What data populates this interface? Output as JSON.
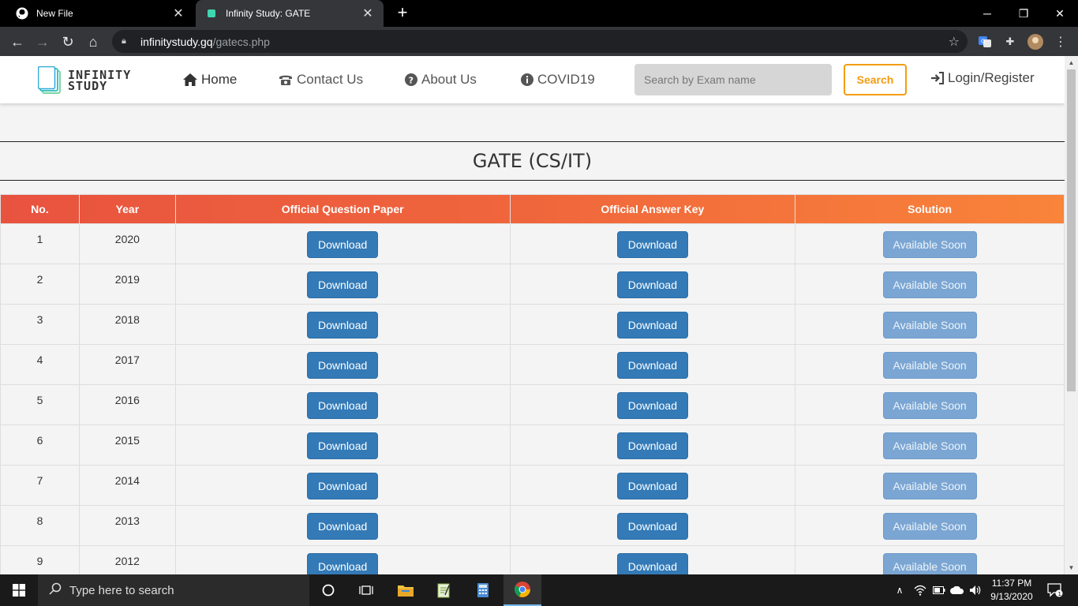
{
  "browser": {
    "tabs": [
      {
        "title": "New File",
        "active": false
      },
      {
        "title": "Infinity Study: GATE",
        "active": true
      }
    ],
    "url_host": "infinitystudy.gq",
    "url_path": "/gatecs.php"
  },
  "site": {
    "brand_line1": "INFINITY",
    "brand_line2": "STUDY",
    "nav": [
      {
        "label": "Home",
        "icon": "home-icon"
      },
      {
        "label": "Contact Us",
        "icon": "phone-icon"
      },
      {
        "label": "About Us",
        "icon": "question-circle-icon"
      },
      {
        "label": "COVID19",
        "icon": "info-circle-icon"
      }
    ],
    "search_placeholder": "Search by Exam name",
    "search_label": "Search",
    "login_label": "Login/Register"
  },
  "page": {
    "title": "GATE (CS/IT)",
    "columns": [
      "No.",
      "Year",
      "Official Question Paper",
      "Official Answer Key",
      "Solution"
    ],
    "rows": [
      {
        "no": "1",
        "year": "2020",
        "paper": "Download",
        "key": "Download",
        "solution": "Available Soon"
      },
      {
        "no": "2",
        "year": "2019",
        "paper": "Download",
        "key": "Download",
        "solution": "Available Soon"
      },
      {
        "no": "3",
        "year": "2018",
        "paper": "Download",
        "key": "Download",
        "solution": "Available Soon"
      },
      {
        "no": "4",
        "year": "2017",
        "paper": "Download",
        "key": "Download",
        "solution": "Available Soon"
      },
      {
        "no": "5",
        "year": "2016",
        "paper": "Download",
        "key": "Download",
        "solution": "Available Soon"
      },
      {
        "no": "6",
        "year": "2015",
        "paper": "Download",
        "key": "Download",
        "solution": "Available Soon"
      },
      {
        "no": "7",
        "year": "2014",
        "paper": "Download",
        "key": "Download",
        "solution": "Available Soon"
      },
      {
        "no": "8",
        "year": "2013",
        "paper": "Download",
        "key": "Download",
        "solution": "Available Soon"
      },
      {
        "no": "9",
        "year": "2012",
        "paper": "Download",
        "key": "Download",
        "solution": "Available Soon"
      }
    ]
  },
  "taskbar": {
    "search_placeholder": "Type here to search",
    "time": "11:37 PM",
    "date": "9/13/2020",
    "notification_count": "1"
  },
  "colors": {
    "header_gradient_start": "#e8533f",
    "header_gradient_end": "#f9843a",
    "download_button": "#337ab7",
    "available_soon_button": "#7ba6d3",
    "search_button_accent": "#f39c12"
  }
}
